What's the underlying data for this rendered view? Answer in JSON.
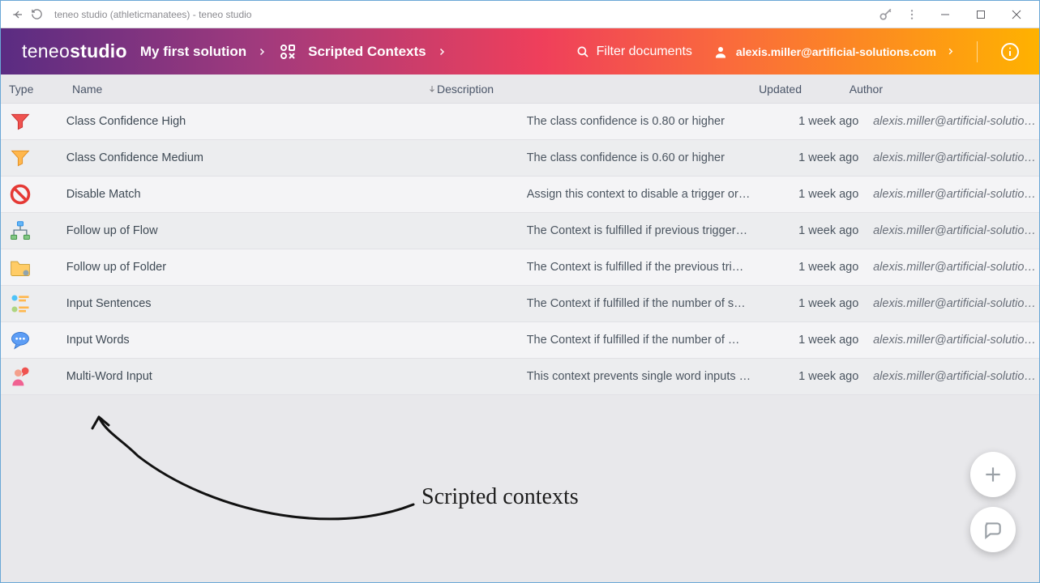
{
  "window": {
    "title": "teneo studio (athleticmanatees) - teneo studio"
  },
  "appbar": {
    "brand_light": "teneo",
    "brand_bold": "studio",
    "breadcrumb": {
      "solution": "My first solution",
      "section": "Scripted Contexts"
    },
    "filter_label": "Filter documents",
    "user_email": "alexis.miller@artificial-solutions.com"
  },
  "columns": {
    "type": "Type",
    "name": "Name",
    "description": "Description",
    "updated": "Updated",
    "author": "Author"
  },
  "rows": [
    {
      "icon": "funnel-red",
      "name": "Class Confidence High",
      "description": "The class confidence is 0.80 or higher",
      "updated": "1 week ago",
      "author": "alexis.miller@artificial-solutions.com"
    },
    {
      "icon": "funnel-amber",
      "name": "Class Confidence Medium",
      "description": "The class confidence is 0.60 or higher",
      "updated": "1 week ago",
      "author": "alexis.miller@artificial-solutions.com"
    },
    {
      "icon": "no-entry",
      "name": "Disable Match",
      "description": "Assign this context to disable a trigger or…",
      "updated": "1 week ago",
      "author": "alexis.miller@artificial-solutions.com"
    },
    {
      "icon": "flow",
      "name": "Follow up of Flow",
      "description": "The Context is fulfilled if previous trigger…",
      "updated": "1 week ago",
      "author": "alexis.miller@artificial-solutions.com"
    },
    {
      "icon": "folder",
      "name": "Follow up of Folder",
      "description": "The Context is fulfilled if the previous tri…",
      "updated": "1 week ago",
      "author": "alexis.miller@artificial-solutions.com"
    },
    {
      "icon": "sentences",
      "name": "Input Sentences",
      "description": "The Context if fulfilled if the number of s…",
      "updated": "1 week ago",
      "author": "alexis.miller@artificial-solutions.com"
    },
    {
      "icon": "speech",
      "name": "Input Words",
      "description": "The Context if fulfilled if the number of …",
      "updated": "1 week ago",
      "author": "alexis.miller@artificial-solutions.com"
    },
    {
      "icon": "person",
      "name": "Multi-Word Input",
      "description": "This context prevents single word inputs …",
      "updated": "1 week ago",
      "author": "alexis.miller@artificial-solutions.com"
    }
  ],
  "annotation": {
    "label": "Scripted contexts"
  }
}
